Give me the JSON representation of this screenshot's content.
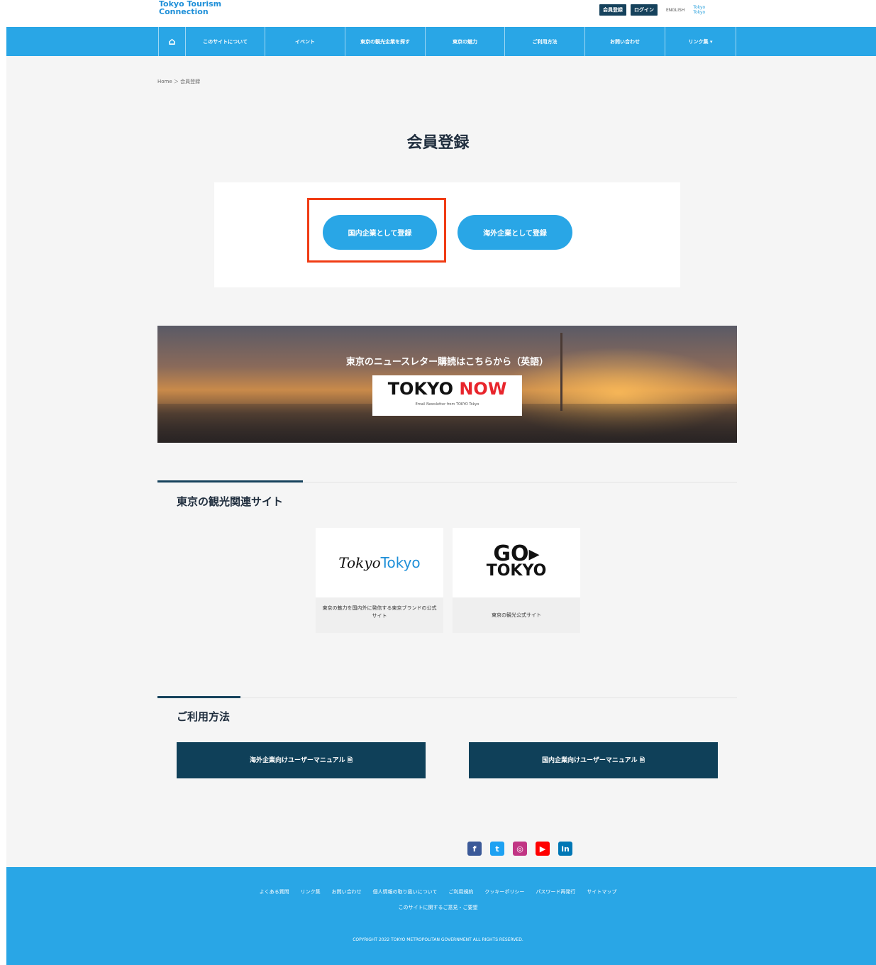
{
  "header": {
    "logo_line1": "Tokyo Tourism",
    "logo_line2": "Connection",
    "register_label": "会員登録",
    "login_label": "ログイン",
    "lang_label": "ENGLISH",
    "mini_logo_line1": "Tokyo",
    "mini_logo_line2": "Tokyo"
  },
  "nav": {
    "home_icon": "home-icon",
    "items": [
      {
        "label": "このサイトについて"
      },
      {
        "label": "イベント"
      },
      {
        "label": "東京の観光企業を探す"
      },
      {
        "label": "東京の魅力"
      },
      {
        "label": "ご利用方法"
      },
      {
        "label": "お問い合わせ"
      },
      {
        "label": "リンク集 ▾"
      }
    ]
  },
  "breadcrumb": {
    "text": "Home ＞ 会員登録"
  },
  "page": {
    "title": "会員登録"
  },
  "registration": {
    "domestic_label": "国内企業として登録",
    "overseas_label": "海外企業として登録"
  },
  "banner": {
    "text": "東京のニュースレター購読はこちらから（英語）",
    "logo_tokyo": "TOKYO ",
    "logo_now": "NOW",
    "logo_sub": "Email Newsletter from TOKYO Tokyo"
  },
  "related": {
    "title": "東京の観光関連サイト",
    "sites": [
      {
        "logo_a": "Tokyo",
        "logo_b": "Tokyo",
        "desc": "東京の魅力を国内外に発信する東京ブランドの公式サイト"
      },
      {
        "logo_go": "GO▸",
        "logo_tokyo": "TOKYO",
        "desc": "東京の観光公式サイト"
      }
    ]
  },
  "usage": {
    "title": "ご利用方法",
    "overseas_manual": "海外企業向けユーザーマニュアル 🗎",
    "domestic_manual": "国内企業向けユーザーマニュアル 🗎"
  },
  "social": {
    "icons": [
      "facebook-icon",
      "twitter-icon",
      "instagram-icon",
      "youtube-icon",
      "linkedin-icon"
    ],
    "colors": {
      "facebook": "#3b5998",
      "twitter": "#1da1f2",
      "instagram": "#c13584",
      "youtube": "#ff0000",
      "linkedin": "#0077b5"
    }
  },
  "footer": {
    "links": [
      "よくある質問",
      "リンク集",
      "お問い合わせ",
      "個人情報の取り扱いについて",
      "ご利用規約",
      "クッキーポリシー",
      "パスワード再発行",
      "サイトマップ"
    ],
    "link2": "このサイトに関するご意見・ご要望",
    "copyright": "COPYRIGHT 2022 TOKYO METROPOLITAN GOVERNMENT ALL RIGHTS RESERVED."
  },
  "colors": {
    "accent": "#29a6e6",
    "navy": "#0f4059",
    "highlight": "#f03c14"
  }
}
